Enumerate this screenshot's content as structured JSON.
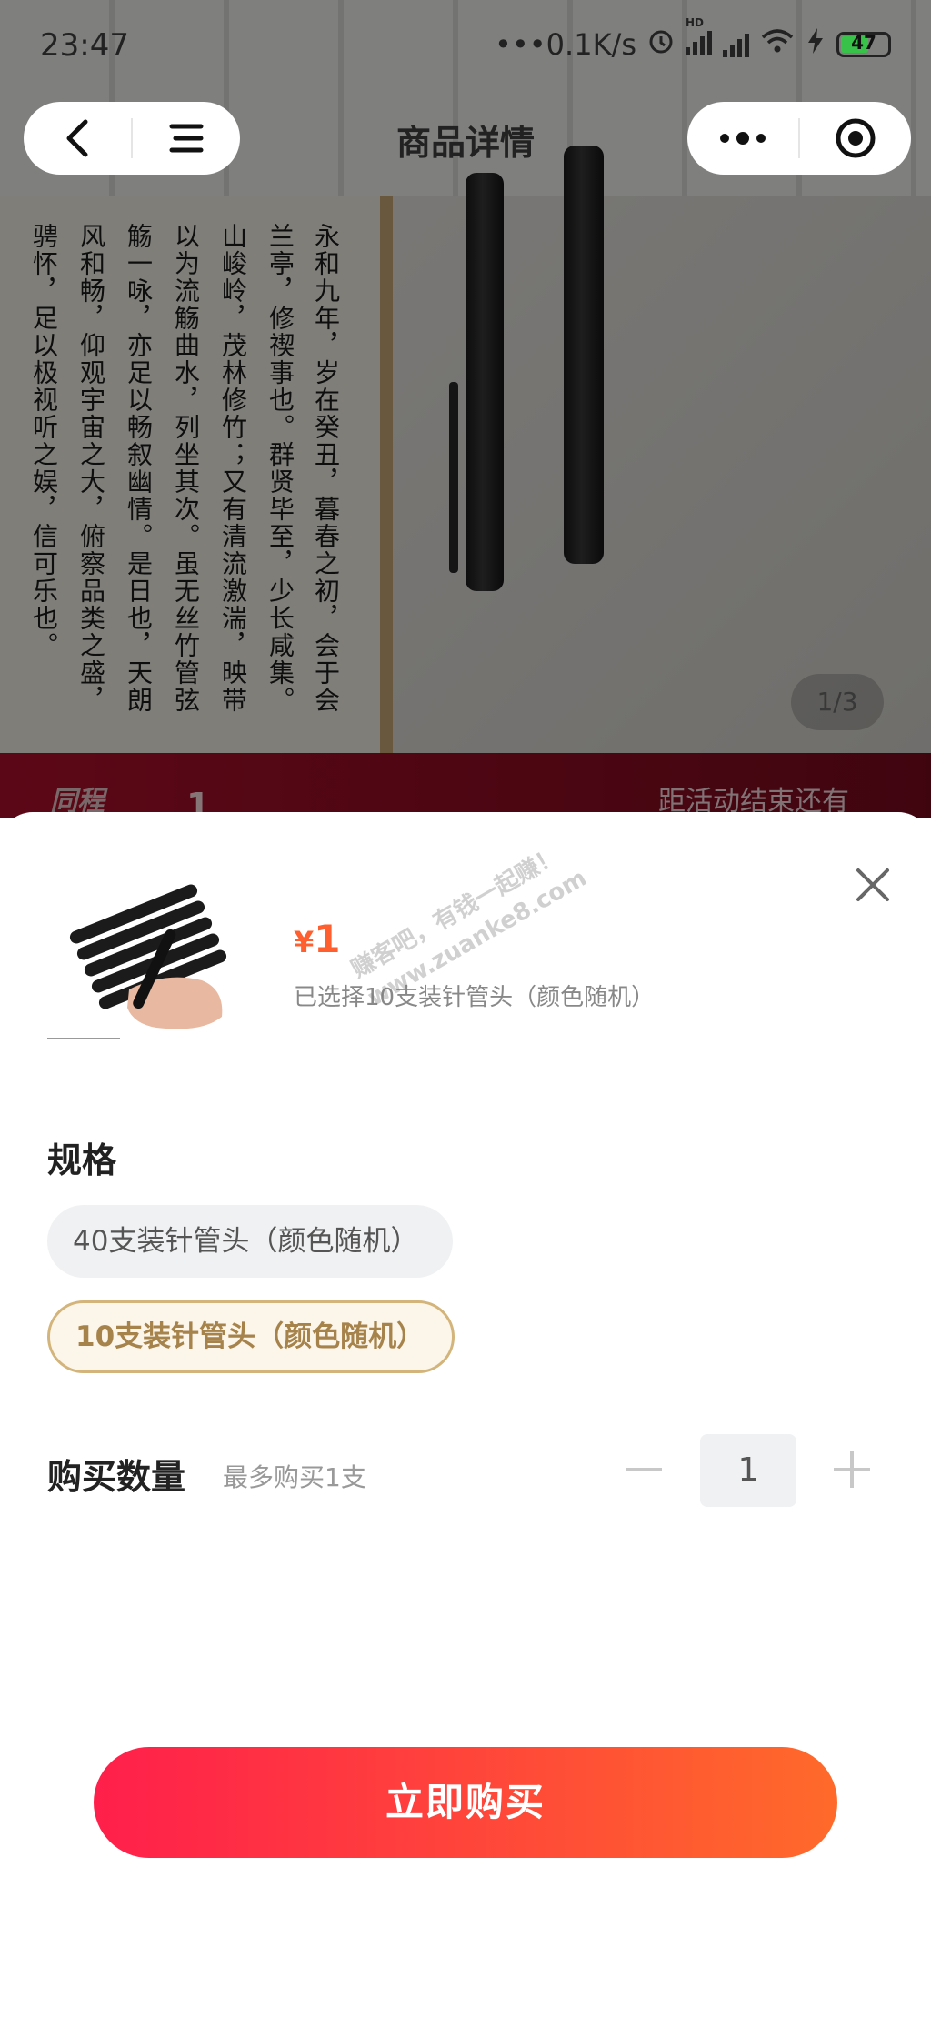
{
  "status_bar": {
    "time": "23:47",
    "network_speed": "•••0.1K/s",
    "hd_label": "HD",
    "battery": "47"
  },
  "nav": {
    "title": "商品详情"
  },
  "background": {
    "book_columns": [
      "永和九年，岁在癸丑，暮春之初，会于会",
      "兰亭，修禊事也。群贤毕至，少长咸集。",
      "山峻岭，茂林修竹；又有清流激湍，映带",
      "以为流觞曲水，列坐其次。虽无丝竹管弦",
      "觞一咏，亦足以畅叙幽情。是日也，天朗",
      "风和畅，仰观宇宙之大，俯察品类之盛，",
      "骋怀，足以极视听之娱，信可乐也。"
    ],
    "image_counter": "1/3",
    "promo_logo": "同程",
    "promo_price": "1",
    "promo_countdown_label": "距活动结束还有"
  },
  "sheet": {
    "price_symbol": "¥",
    "price_value": "1",
    "selected_text": "已选择10支装针管头（颜色随机）",
    "watermark_line1": "赚客吧，有钱一起赚！",
    "watermark_line2": "www.zuanke8.com",
    "spec_title": "规格",
    "spec_options": [
      {
        "label": "40支装针管头（颜色随机）",
        "selected": false
      },
      {
        "label": "10支装针管头（颜色随机）",
        "selected": true
      }
    ],
    "quantity_title": "购买数量",
    "quantity_limit": "最多购买1支",
    "quantity_value": "1",
    "buy_button": "立即购买"
  },
  "colors": {
    "price": "#ff5f2e",
    "selected_border": "#d3b47a",
    "selected_text": "#a7834c",
    "buy_gradient_start": "#ff1f4b",
    "buy_gradient_end": "#ff6a2a"
  },
  "icons": [
    "back-icon",
    "menu-icon",
    "more-icon",
    "target-icon",
    "close-icon",
    "minus-icon",
    "plus-icon",
    "alarm-icon",
    "signal-icon",
    "wifi-icon",
    "charging-icon",
    "battery-icon"
  ]
}
